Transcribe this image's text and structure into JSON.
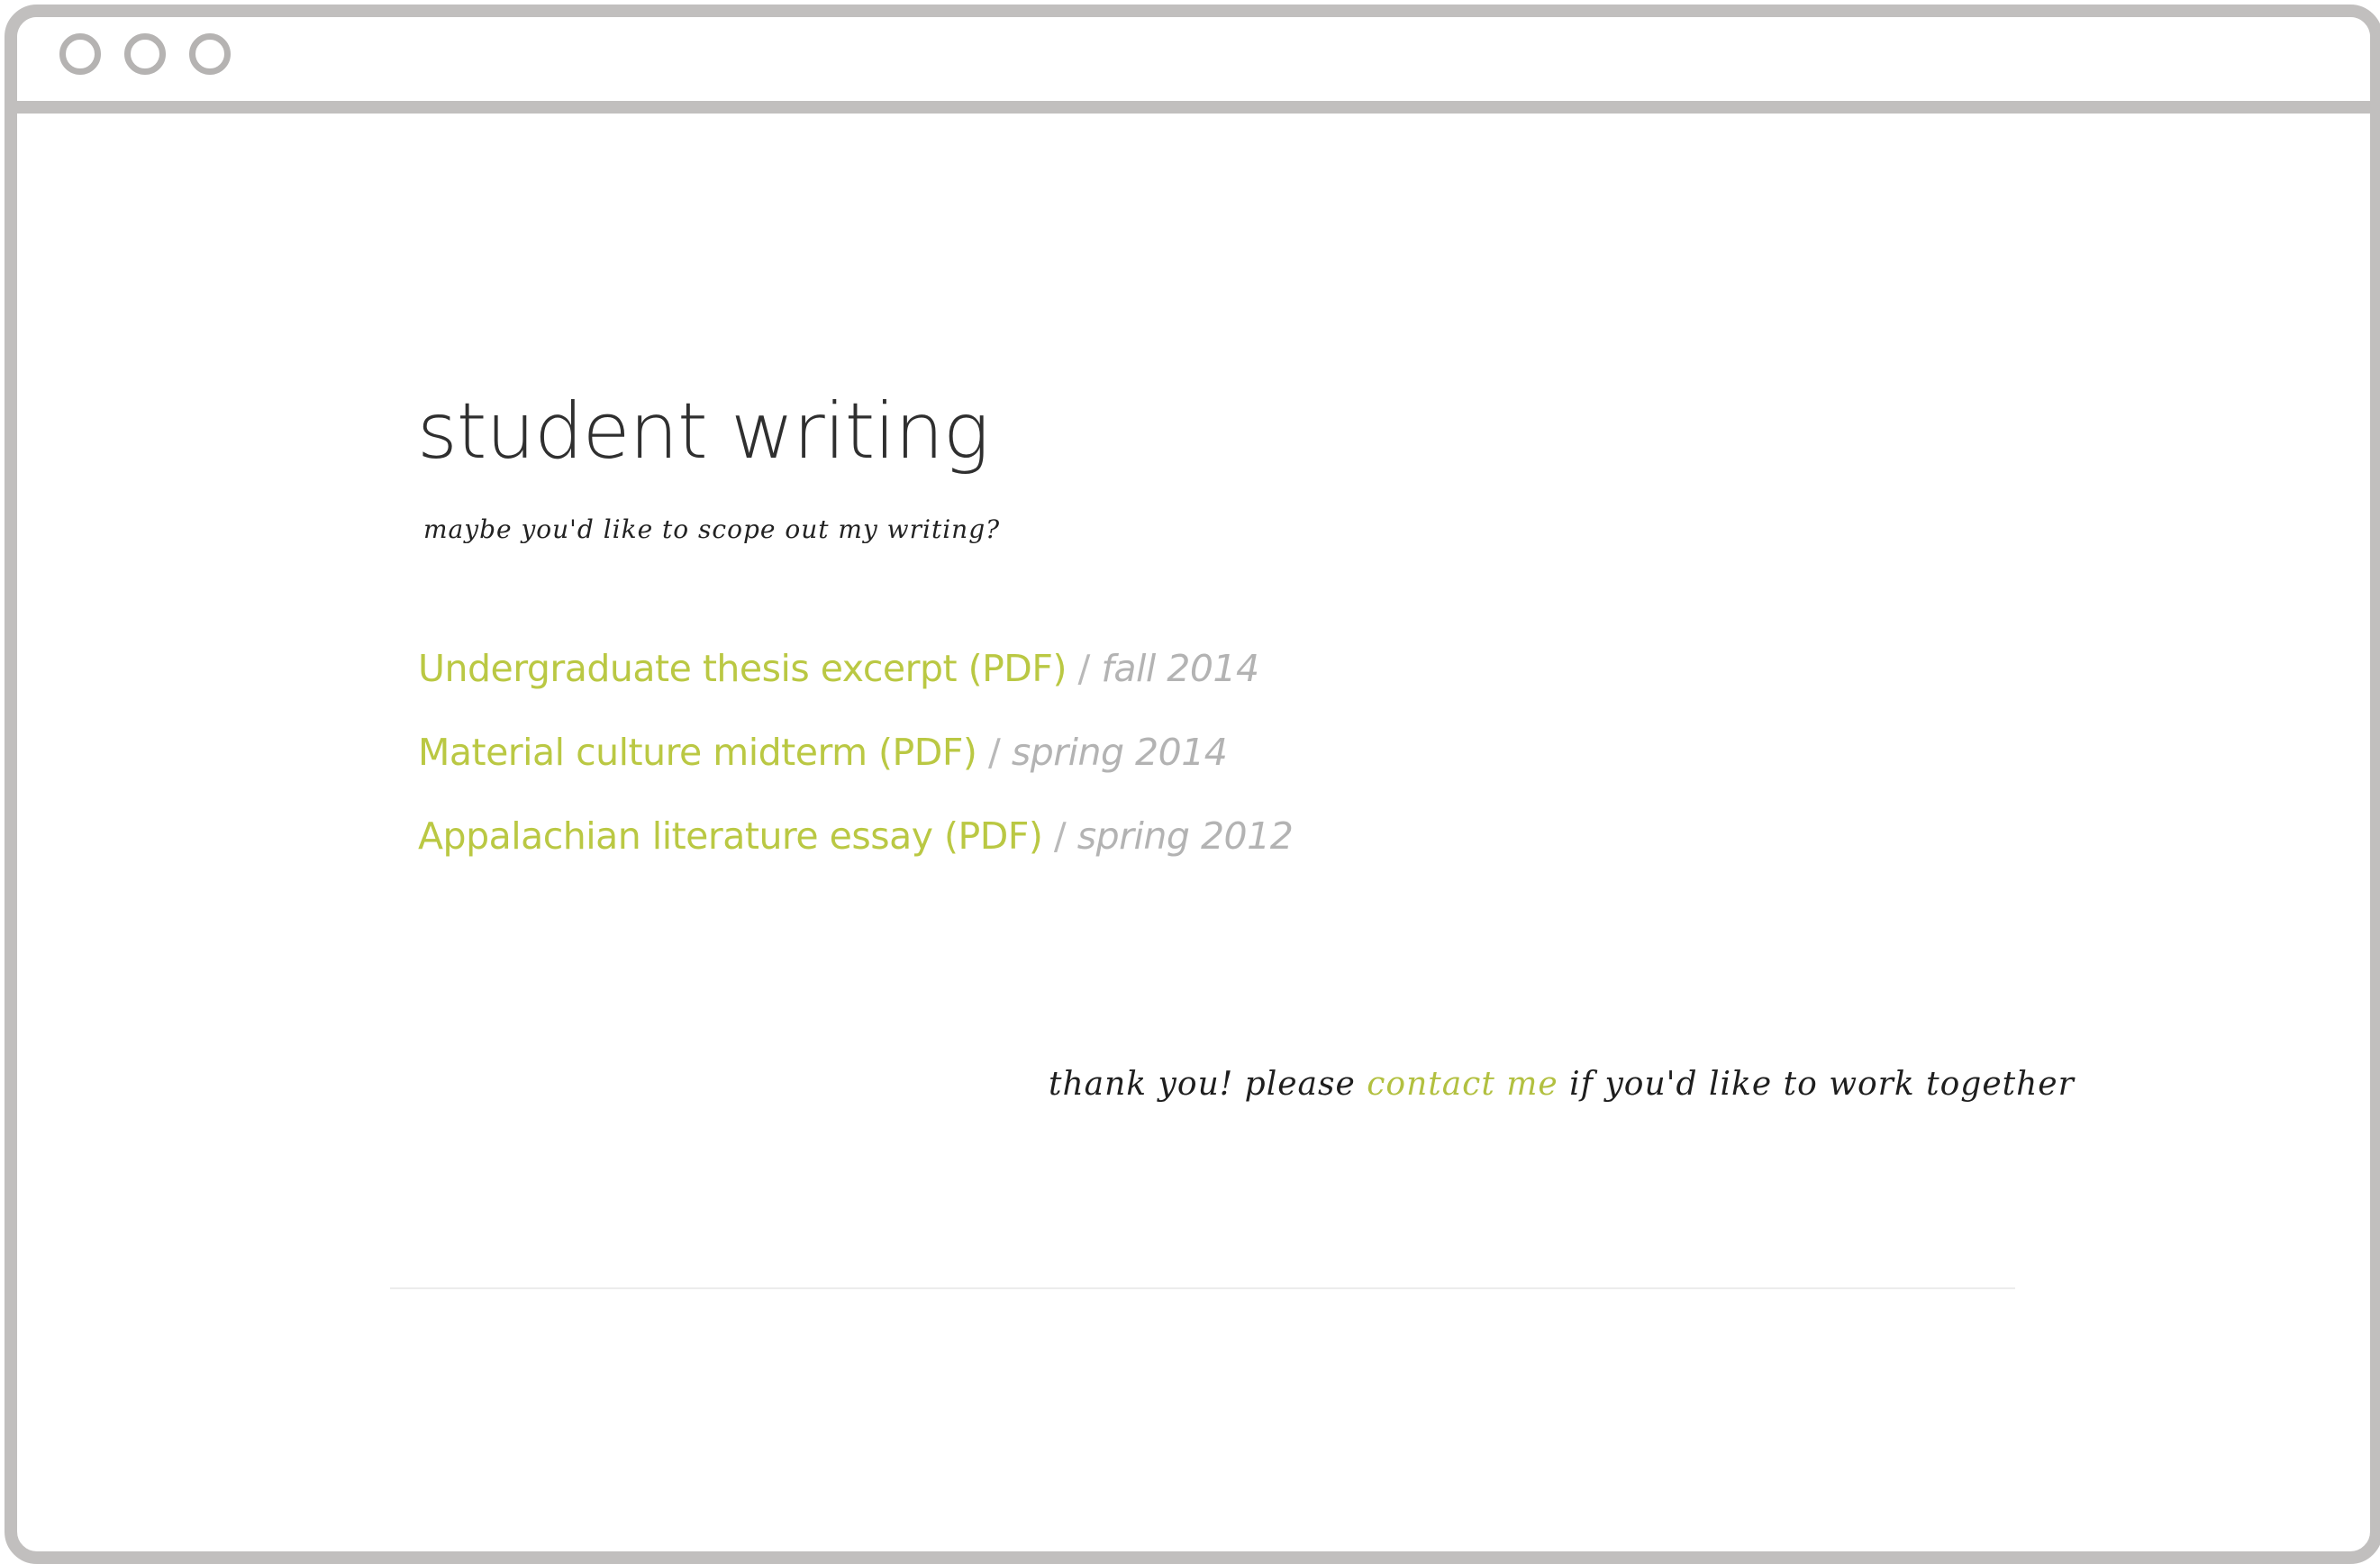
{
  "page": {
    "title": "student writing",
    "subtitle": "maybe you'd like to scope out my writing?"
  },
  "writing": [
    {
      "title": "Undergraduate thesis excerpt (PDF)",
      "separator": "/",
      "date": "fall 2014"
    },
    {
      "title": "Material culture midterm (PDF)",
      "separator": "/",
      "date": "spring 2014"
    },
    {
      "title": "Appalachian literature essay (PDF)",
      "separator": "/",
      "date": "spring 2012"
    }
  ],
  "footer": {
    "prefix": "thank you! please",
    "link": "contact me",
    "suffix": "if you'd like to work together"
  },
  "colors": {
    "accent": "#bac843",
    "frame": "#c1bfbe",
    "date": "#b3b3b3",
    "text": "#2f2f2f"
  }
}
